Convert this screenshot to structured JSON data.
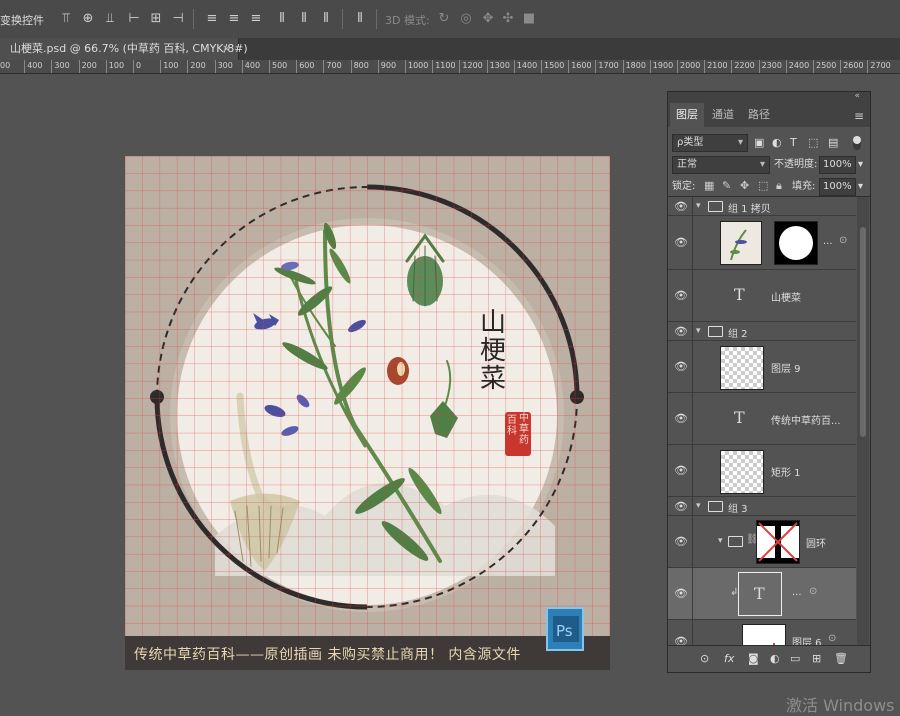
{
  "options_bar": {
    "label": "变换控件",
    "mode_3d_label": "3D 模式:",
    "icons": [
      "align-top-icon",
      "align-vcenter-icon",
      "align-bottom-icon",
      "align-left-icon",
      "align-hcenter-icon",
      "align-right-icon",
      "distribute-top-icon",
      "distribute-vcenter-icon",
      "distribute-bottom-icon",
      "distribute-left-icon",
      "distribute-hcenter-icon",
      "distribute-right-icon",
      "auto-align-icon",
      "rotate-3d-icon",
      "roll-3d-icon",
      "drag-3d-icon",
      "slide-3d-icon",
      "scale-3d-icon"
    ]
  },
  "document_tab": {
    "title": "山梗菜.psd @ 66.7% (中草药  百科, CMYK/8#)",
    "close": "×"
  },
  "ruler": {
    "ticks": [
      "00",
      "400",
      "300",
      "200",
      "100",
      "0",
      "100",
      "200",
      "300",
      "400",
      "500",
      "600",
      "700",
      "800",
      "900",
      "1000",
      "1100",
      "1200",
      "1300",
      "1400",
      "1500",
      "1600",
      "1700",
      "1800",
      "1900",
      "2000",
      "2100",
      "2200",
      "2300",
      "2400",
      "2500",
      "2600",
      "2700"
    ]
  },
  "artwork": {
    "title_chars": [
      "山",
      "梗",
      "菜"
    ],
    "seal_col1": [
      "百",
      "科"
    ],
    "seal_col2": [
      "中",
      "草",
      "药"
    ],
    "banner": "传统中草药百科——原创插画 未购买禁止商用！ 内含源文件",
    "colors": {
      "background": "#bcb0a4",
      "circle": "#f1ede6",
      "ring": "#2f2b2a",
      "banner": "#3f3a38",
      "seal": "#c8362e",
      "grid": "#e0403a"
    }
  },
  "layers_panel": {
    "tabs": [
      "图层",
      "通道",
      "路径"
    ],
    "filter_kind": "ρ类型",
    "blend_mode": "正常",
    "opacity_label": "不透明度:",
    "opacity_value": "100%",
    "lock_label": "锁定:",
    "fill_label": "填充:",
    "fill_value": "100%",
    "layers": [
      {
        "name": "组 1 拷贝",
        "kind": "group"
      },
      {
        "name": "",
        "kind": "masked-image",
        "suffix": "..."
      },
      {
        "name": "山梗菜",
        "kind": "text"
      },
      {
        "name": "组 2",
        "kind": "group"
      },
      {
        "name": "图层 9",
        "kind": "pixel"
      },
      {
        "name": "传统中草药百...",
        "kind": "text"
      },
      {
        "name": "矩形 1",
        "kind": "shape"
      },
      {
        "name": "组 3",
        "kind": "group"
      },
      {
        "name": "圆环",
        "kind": "group-mask"
      },
      {
        "name": "...",
        "kind": "text-selected"
      },
      {
        "name": "图层 6",
        "kind": "pixel"
      }
    ]
  },
  "system": {
    "watermark": "激活 Windows"
  }
}
